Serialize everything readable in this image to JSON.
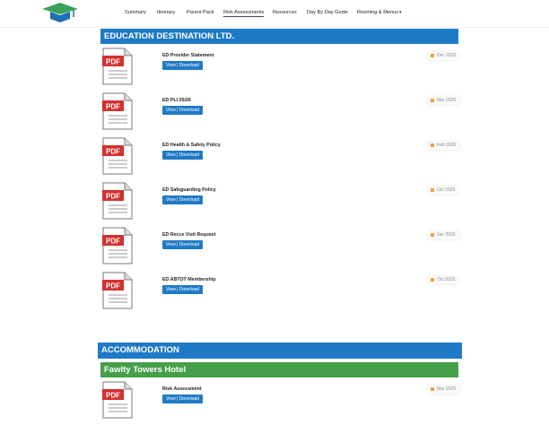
{
  "nav": {
    "items": [
      "Summary",
      "Itinerary",
      "Parent Pack",
      "Risk Assessments",
      "Resources",
      "Day By Day Guide",
      "Rooming & Menus"
    ],
    "active": "Risk Assessments"
  },
  "sections": {
    "education": {
      "title": "EDUCATION DESTINATION LTD."
    },
    "accommodation": {
      "title": "ACCOMMODATION"
    },
    "hotel": {
      "title": "Fawlty Towers Hotel"
    }
  },
  "pdf_label": "PDF",
  "button_label": "View | Download",
  "documents": [
    {
      "title": "ED Provider Statement",
      "date": "Dec 2025"
    },
    {
      "title": "ED PLI 25/26",
      "date": "Mar 2025"
    },
    {
      "title": "ED Health & Safety Policy",
      "date": "Feb 2026"
    },
    {
      "title": "ED Safeguarding Policy",
      "date": "Oct 2025"
    },
    {
      "title": "ED Recce Visit Request",
      "date": "Jun 2025"
    },
    {
      "title": "ED ABTOT Membership",
      "date": "Oct 2025"
    },
    {
      "title": "Risk Assessment",
      "date": "Mar 2025"
    }
  ],
  "colors": {
    "primary": "#1f7ac6",
    "hotel": "#46a04a",
    "pdf_red": "#d32f2f",
    "date_icon": "#f0a040"
  }
}
